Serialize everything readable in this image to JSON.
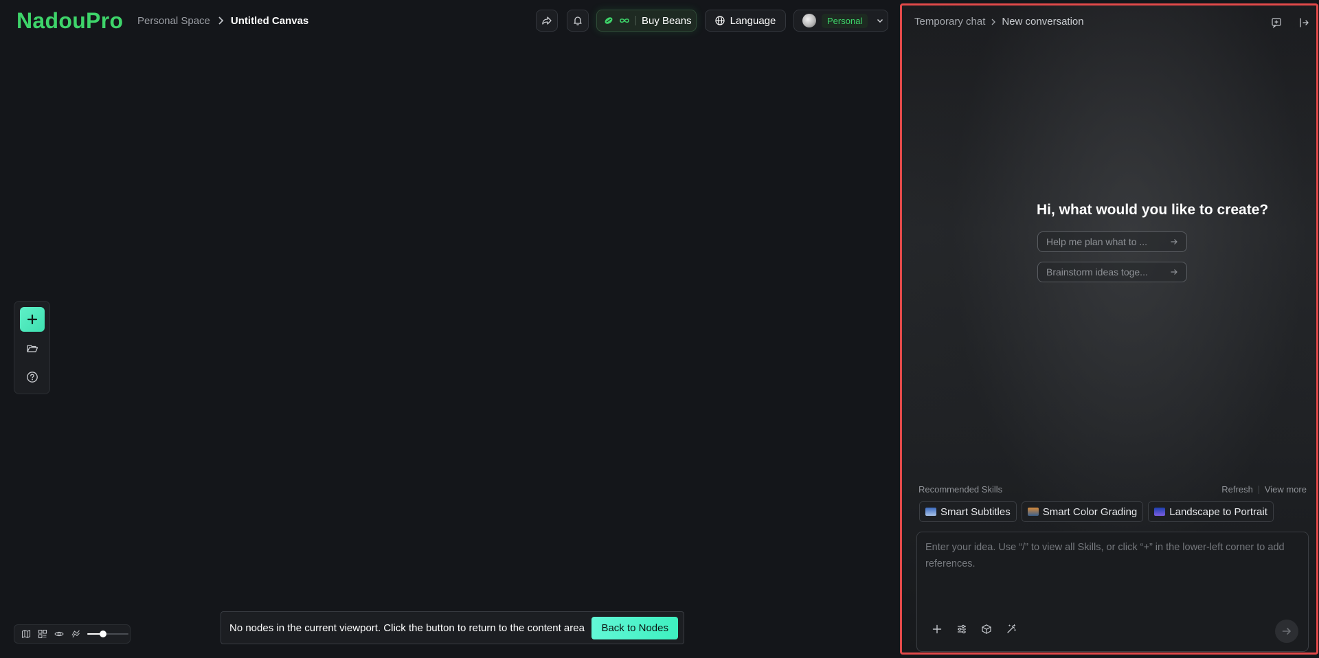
{
  "header": {
    "logo": "NadouPro",
    "breadcrumb": {
      "space": "Personal Space",
      "canvas": "Untitled Canvas"
    },
    "buy_beans_label": "Buy Beans",
    "language_label": "Language",
    "profile_badge": "Personal"
  },
  "icons": {
    "share": "share-icon",
    "bell": "bell-icon",
    "bean": "bean-icon",
    "infinity": "infinity-icon",
    "globe": "globe-icon",
    "chevron": "chevron-down-icon",
    "plus": "plus-icon",
    "folder": "folder-icon",
    "help": "help-icon"
  },
  "colors": {
    "brand": "#3ed46a",
    "accent_button": "#3ef0c0",
    "panel_highlight_border": "#e34a4a",
    "background": "#14161a"
  },
  "bottom_controls": {
    "zoom_fraction": 0.35
  },
  "notice": {
    "text": "No nodes in the current viewport. Click the button to return to the content area",
    "button": "Back to Nodes"
  },
  "chat": {
    "breadcrumb": {
      "root": "Temporary chat",
      "current": "New conversation"
    },
    "greeting": "Hi, what would you like to create?",
    "suggestions": [
      "Help me plan what to ...",
      "Brainstorm ideas toge..."
    ],
    "skills": {
      "label": "Recommended Skills",
      "refresh": "Refresh",
      "view_more": "View more",
      "items": [
        "Smart Subtitles",
        "Smart Color Grading",
        "Landscape to Portrait"
      ]
    },
    "input": {
      "placeholder": "Enter your idea. Use “/” to view all Skills, or click “+” in the lower-left corner to add references.",
      "value": ""
    }
  }
}
